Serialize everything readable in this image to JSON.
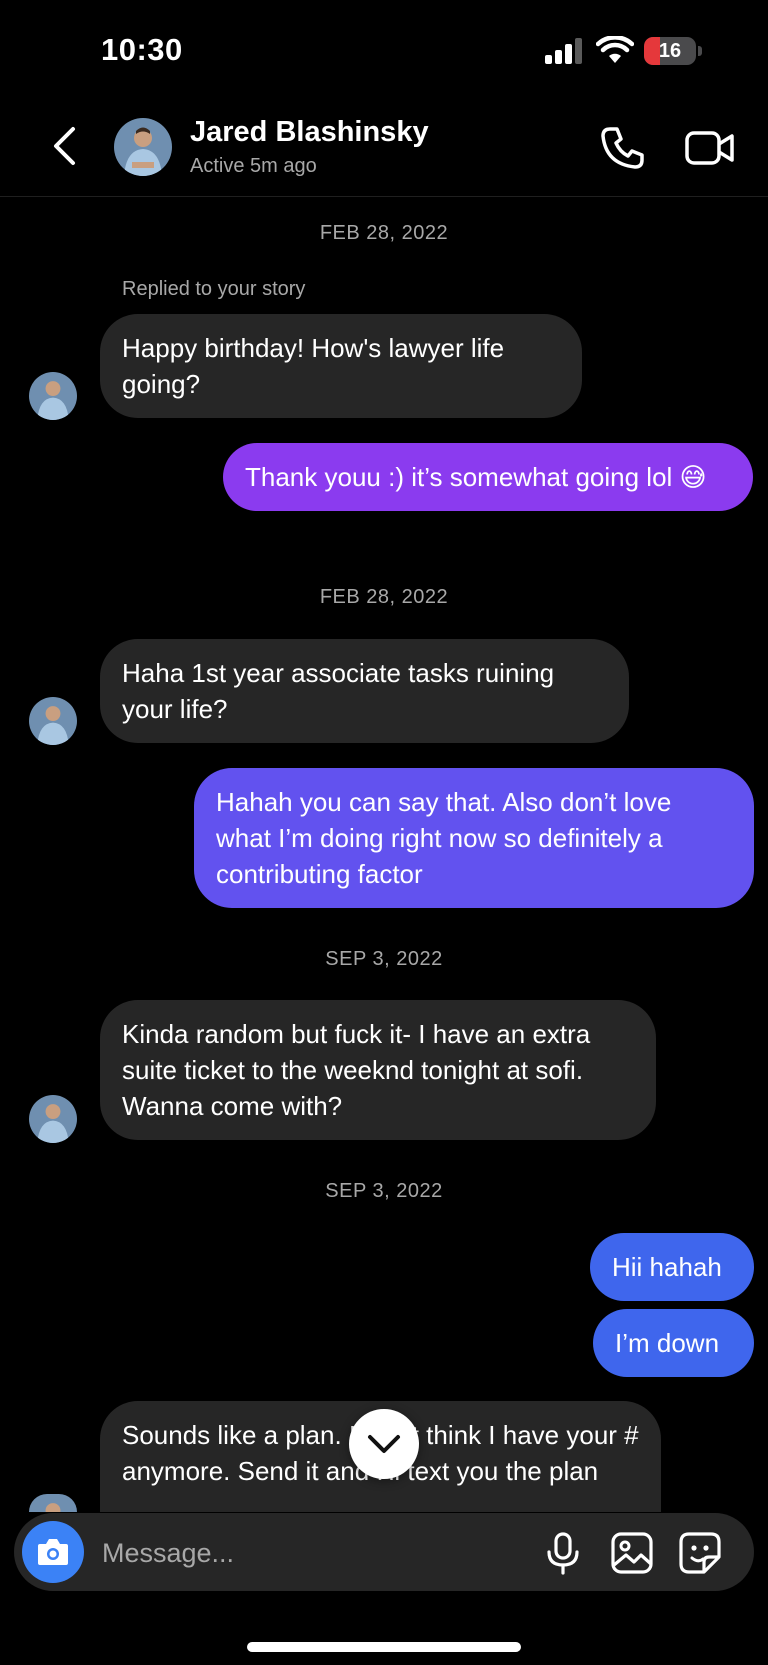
{
  "status_bar": {
    "time": "10:30",
    "battery_level": "16"
  },
  "header": {
    "contact_name": "Jared Blashinsky",
    "contact_status": "Active 5m ago",
    "icons": [
      "chevron-left-icon",
      "phone-icon",
      "video-camera-icon"
    ]
  },
  "chat": {
    "date_1": "FEB 28, 2022",
    "reply_note": "Replied to your story",
    "msg_1": "Happy birthday! How's lawyer life going?",
    "msg_2": "Thank youu :) it’s somewhat going lol 😅",
    "date_2": "FEB 28, 2022",
    "msg_3": "Haha 1st year associate tasks ruining your life?",
    "msg_4": "Hahah you can say that. Also don’t love what I’m doing right now so definitely a contributing factor",
    "date_3": "SEP 3, 2022",
    "msg_5": "Kinda random but fuck it- I have an extra suite ticket to the weeknd tonight at sofi. Wanna come with?",
    "date_4": "SEP 3, 2022",
    "msg_6": "Hii hahah",
    "msg_7": "I’m down",
    "msg_8": "Sounds like a plan. I don't think I have your # anymore. Send it and I'll text you the plan"
  },
  "composer": {
    "placeholder": "Message...",
    "icons": [
      "camera-icon",
      "microphone-icon",
      "gallery-icon",
      "sticker-icon"
    ]
  },
  "colors": {
    "background": "#000000",
    "incoming_bubble": "#262626",
    "outgoing_purple": "#8b3bef",
    "outgoing_indigo": "#6252ef",
    "outgoing_blue": "#3f66ed",
    "camera_button": "#3b82f6",
    "muted_text": "#a8a8a8"
  }
}
